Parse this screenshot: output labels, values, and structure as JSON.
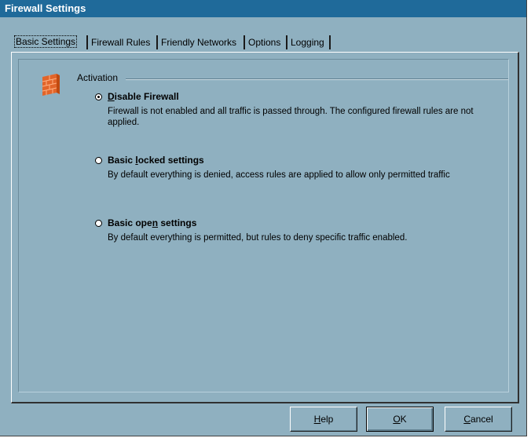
{
  "window": {
    "title": "Firewall Settings"
  },
  "tabs": [
    {
      "label": "Basic Settings",
      "active": true
    },
    {
      "label": "Firewall Rules",
      "active": false
    },
    {
      "label": "Friendly Networks",
      "active": false
    },
    {
      "label": "Options",
      "active": false
    },
    {
      "label": "Logging",
      "active": false
    }
  ],
  "group": {
    "label": "Activation",
    "icon": "brick-wall-icon"
  },
  "options": [
    {
      "label_pre": "",
      "label_key": "D",
      "label_post": "isable Firewall",
      "description": "Firewall is not enabled and all traffic is passed through. The configured firewall rules are not applied.",
      "checked": true
    },
    {
      "label_pre": "Basic ",
      "label_key": "l",
      "label_post": "ocked settings",
      "description": "By default everything is denied, access rules are applied to allow only permitted traffic",
      "checked": false
    },
    {
      "label_pre": "Basic ope",
      "label_key": "n",
      "label_post": " settings",
      "description": "By default everything is permitted, but rules to deny specific traffic enabled.",
      "checked": false
    }
  ],
  "buttons": {
    "help": {
      "key": "H",
      "rest": "elp"
    },
    "ok": {
      "key": "O",
      "rest": "K"
    },
    "cancel": {
      "key": "C",
      "rest": "ancel"
    }
  },
  "colors": {
    "background": "#8fb0c0",
    "titlebar": "#1f6a9a",
    "title_text": "#ffffff"
  }
}
